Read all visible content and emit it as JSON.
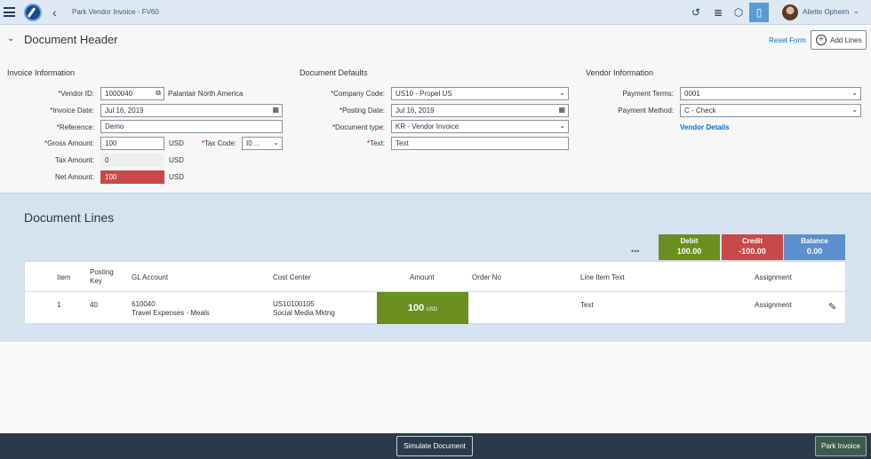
{
  "shell": {
    "title": "Park Vendor Invoice - FV60",
    "user": "Aliette Opheim"
  },
  "header": {
    "title": "Document Header",
    "reset": "Reset Form",
    "add_lines": "Add Lines"
  },
  "sections": {
    "invoice": "Invoice Information",
    "defaults": "Document Defaults",
    "vendor": "Vendor Information"
  },
  "invoice": {
    "vendor_id_label": "Vendor ID:",
    "vendor_id": "1000040",
    "vendor_name": "Palantair North America",
    "invoice_date_label": "Invoice Date:",
    "invoice_date": "Jul 16, 2019",
    "reference_label": "Reference:",
    "reference": "Demo",
    "gross_label": "Gross Amount:",
    "gross": "100",
    "gross_unit": "USD",
    "tax_code_label": "Tax Code:",
    "tax_code": "I0 ...",
    "tax_label": "Tax Amount:",
    "tax": "0",
    "tax_unit": "USD",
    "net_label": "Net Amount:",
    "net": "100",
    "net_unit": "USD"
  },
  "defaults": {
    "company_label": "Company Code:",
    "company": "US10 - Propel US",
    "posting_label": "Posting Date:",
    "posting": "Jul 16, 2019",
    "doctype_label": "Document type:",
    "doctype": "KR - Vendor Invoice",
    "text_label": "Text:",
    "text": "Text"
  },
  "vendor": {
    "terms_label": "Payment Terms:",
    "terms": "0001",
    "method_label": "Payment Method:",
    "method": "C - Check",
    "details": "Vendor Details"
  },
  "lines": {
    "title": "Document Lines",
    "totals": [
      {
        "key": "Debit",
        "value": "100.00",
        "color": "#6a8e1f"
      },
      {
        "key": "Credit",
        "value": "-100.00",
        "color": "#c94848"
      },
      {
        "key": "Balance",
        "value": "0.00",
        "color": "#5b8fd0"
      }
    ],
    "columns": [
      "Item",
      "Posting Key",
      "GL Account",
      "Cost Center",
      "Amount",
      "Order No",
      "Line Item Text",
      "Assignment"
    ],
    "row": {
      "item": "1",
      "posting_key": "40",
      "gl_account": "610040",
      "gl_desc": "Travel Expenses - Meals",
      "cost_center": "US10100105",
      "cc_desc": "Social Media Mktng",
      "amount": "100",
      "amount_unit": "USD",
      "order_no": "",
      "line_text": "Text",
      "assignment": "Assignment"
    }
  },
  "footer": {
    "simulate": "Simulate Document",
    "park": "Park Invoice"
  }
}
